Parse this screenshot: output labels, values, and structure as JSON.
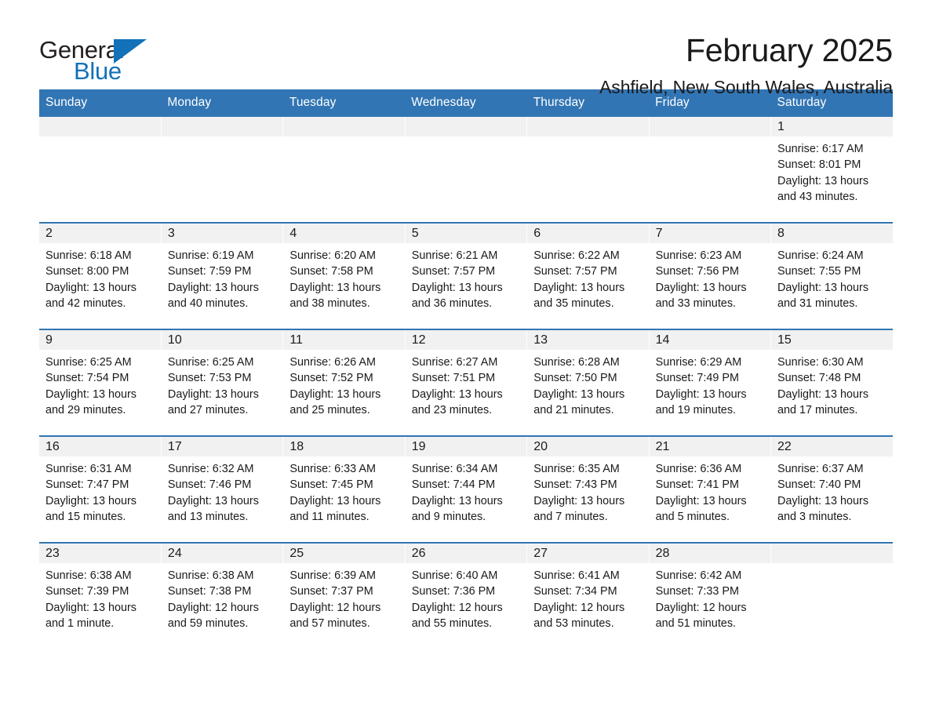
{
  "brand": {
    "name_part1": "General",
    "name_part2": "Blue",
    "accent_color": "#1271b8"
  },
  "header": {
    "title": "February 2025",
    "subtitle": "Ashfield, New South Wales, Australia"
  },
  "theme": {
    "header_blue": "#3275b4",
    "daynum_band": "#f1f1f1",
    "text": "#1a1a1a"
  },
  "weekday_headers": [
    "Sunday",
    "Monday",
    "Tuesday",
    "Wednesday",
    "Thursday",
    "Friday",
    "Saturday"
  ],
  "labels": {
    "sunrise_prefix": "Sunrise:",
    "sunset_prefix": "Sunset:",
    "daylight_prefix": "Daylight:"
  },
  "weeks": [
    [
      {
        "day": "",
        "empty": true
      },
      {
        "day": "",
        "empty": true
      },
      {
        "day": "",
        "empty": true
      },
      {
        "day": "",
        "empty": true
      },
      {
        "day": "",
        "empty": true
      },
      {
        "day": "",
        "empty": true
      },
      {
        "day": "1",
        "sunrise": "Sunrise: 6:17 AM",
        "sunset": "Sunset: 8:01 PM",
        "daylight_line1": "Daylight: 13 hours",
        "daylight_line2": "and 43 minutes."
      }
    ],
    [
      {
        "day": "2",
        "sunrise": "Sunrise: 6:18 AM",
        "sunset": "Sunset: 8:00 PM",
        "daylight_line1": "Daylight: 13 hours",
        "daylight_line2": "and 42 minutes."
      },
      {
        "day": "3",
        "sunrise": "Sunrise: 6:19 AM",
        "sunset": "Sunset: 7:59 PM",
        "daylight_line1": "Daylight: 13 hours",
        "daylight_line2": "and 40 minutes."
      },
      {
        "day": "4",
        "sunrise": "Sunrise: 6:20 AM",
        "sunset": "Sunset: 7:58 PM",
        "daylight_line1": "Daylight: 13 hours",
        "daylight_line2": "and 38 minutes."
      },
      {
        "day": "5",
        "sunrise": "Sunrise: 6:21 AM",
        "sunset": "Sunset: 7:57 PM",
        "daylight_line1": "Daylight: 13 hours",
        "daylight_line2": "and 36 minutes."
      },
      {
        "day": "6",
        "sunrise": "Sunrise: 6:22 AM",
        "sunset": "Sunset: 7:57 PM",
        "daylight_line1": "Daylight: 13 hours",
        "daylight_line2": "and 35 minutes."
      },
      {
        "day": "7",
        "sunrise": "Sunrise: 6:23 AM",
        "sunset": "Sunset: 7:56 PM",
        "daylight_line1": "Daylight: 13 hours",
        "daylight_line2": "and 33 minutes."
      },
      {
        "day": "8",
        "sunrise": "Sunrise: 6:24 AM",
        "sunset": "Sunset: 7:55 PM",
        "daylight_line1": "Daylight: 13 hours",
        "daylight_line2": "and 31 minutes."
      }
    ],
    [
      {
        "day": "9",
        "sunrise": "Sunrise: 6:25 AM",
        "sunset": "Sunset: 7:54 PM",
        "daylight_line1": "Daylight: 13 hours",
        "daylight_line2": "and 29 minutes."
      },
      {
        "day": "10",
        "sunrise": "Sunrise: 6:25 AM",
        "sunset": "Sunset: 7:53 PM",
        "daylight_line1": "Daylight: 13 hours",
        "daylight_line2": "and 27 minutes."
      },
      {
        "day": "11",
        "sunrise": "Sunrise: 6:26 AM",
        "sunset": "Sunset: 7:52 PM",
        "daylight_line1": "Daylight: 13 hours",
        "daylight_line2": "and 25 minutes."
      },
      {
        "day": "12",
        "sunrise": "Sunrise: 6:27 AM",
        "sunset": "Sunset: 7:51 PM",
        "daylight_line1": "Daylight: 13 hours",
        "daylight_line2": "and 23 minutes."
      },
      {
        "day": "13",
        "sunrise": "Sunrise: 6:28 AM",
        "sunset": "Sunset: 7:50 PM",
        "daylight_line1": "Daylight: 13 hours",
        "daylight_line2": "and 21 minutes."
      },
      {
        "day": "14",
        "sunrise": "Sunrise: 6:29 AM",
        "sunset": "Sunset: 7:49 PM",
        "daylight_line1": "Daylight: 13 hours",
        "daylight_line2": "and 19 minutes."
      },
      {
        "day": "15",
        "sunrise": "Sunrise: 6:30 AM",
        "sunset": "Sunset: 7:48 PM",
        "daylight_line1": "Daylight: 13 hours",
        "daylight_line2": "and 17 minutes."
      }
    ],
    [
      {
        "day": "16",
        "sunrise": "Sunrise: 6:31 AM",
        "sunset": "Sunset: 7:47 PM",
        "daylight_line1": "Daylight: 13 hours",
        "daylight_line2": "and 15 minutes."
      },
      {
        "day": "17",
        "sunrise": "Sunrise: 6:32 AM",
        "sunset": "Sunset: 7:46 PM",
        "daylight_line1": "Daylight: 13 hours",
        "daylight_line2": "and 13 minutes."
      },
      {
        "day": "18",
        "sunrise": "Sunrise: 6:33 AM",
        "sunset": "Sunset: 7:45 PM",
        "daylight_line1": "Daylight: 13 hours",
        "daylight_line2": "and 11 minutes."
      },
      {
        "day": "19",
        "sunrise": "Sunrise: 6:34 AM",
        "sunset": "Sunset: 7:44 PM",
        "daylight_line1": "Daylight: 13 hours",
        "daylight_line2": "and 9 minutes."
      },
      {
        "day": "20",
        "sunrise": "Sunrise: 6:35 AM",
        "sunset": "Sunset: 7:43 PM",
        "daylight_line1": "Daylight: 13 hours",
        "daylight_line2": "and 7 minutes."
      },
      {
        "day": "21",
        "sunrise": "Sunrise: 6:36 AM",
        "sunset": "Sunset: 7:41 PM",
        "daylight_line1": "Daylight: 13 hours",
        "daylight_line2": "and 5 minutes."
      },
      {
        "day": "22",
        "sunrise": "Sunrise: 6:37 AM",
        "sunset": "Sunset: 7:40 PM",
        "daylight_line1": "Daylight: 13 hours",
        "daylight_line2": "and 3 minutes."
      }
    ],
    [
      {
        "day": "23",
        "sunrise": "Sunrise: 6:38 AM",
        "sunset": "Sunset: 7:39 PM",
        "daylight_line1": "Daylight: 13 hours",
        "daylight_line2": "and 1 minute."
      },
      {
        "day": "24",
        "sunrise": "Sunrise: 6:38 AM",
        "sunset": "Sunset: 7:38 PM",
        "daylight_line1": "Daylight: 12 hours",
        "daylight_line2": "and 59 minutes."
      },
      {
        "day": "25",
        "sunrise": "Sunrise: 6:39 AM",
        "sunset": "Sunset: 7:37 PM",
        "daylight_line1": "Daylight: 12 hours",
        "daylight_line2": "and 57 minutes."
      },
      {
        "day": "26",
        "sunrise": "Sunrise: 6:40 AM",
        "sunset": "Sunset: 7:36 PM",
        "daylight_line1": "Daylight: 12 hours",
        "daylight_line2": "and 55 minutes."
      },
      {
        "day": "27",
        "sunrise": "Sunrise: 6:41 AM",
        "sunset": "Sunset: 7:34 PM",
        "daylight_line1": "Daylight: 12 hours",
        "daylight_line2": "and 53 minutes."
      },
      {
        "day": "28",
        "sunrise": "Sunrise: 6:42 AM",
        "sunset": "Sunset: 7:33 PM",
        "daylight_line1": "Daylight: 12 hours",
        "daylight_line2": "and 51 minutes."
      },
      {
        "day": "",
        "empty": true
      }
    ]
  ]
}
